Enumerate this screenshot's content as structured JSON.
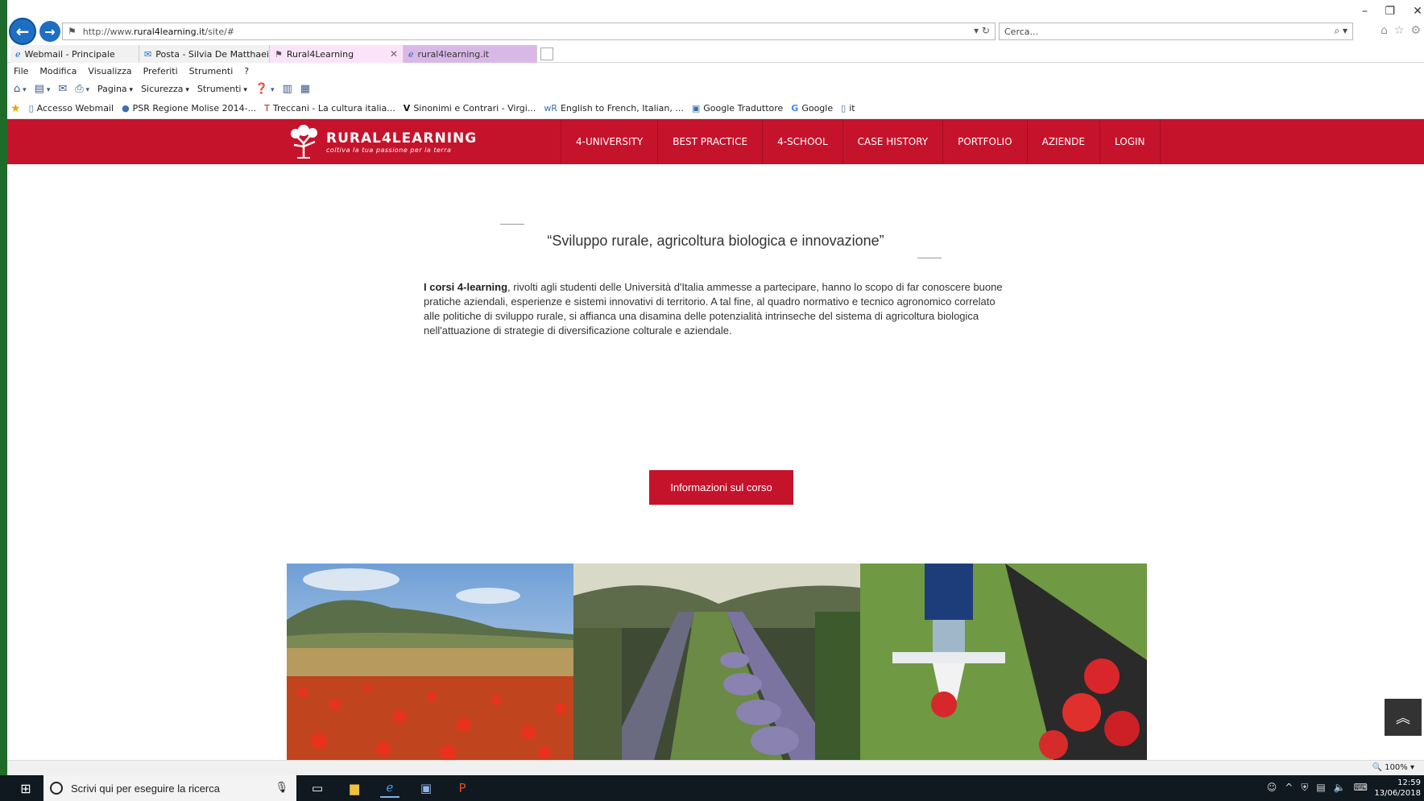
{
  "browser": {
    "address": {
      "prefix": "http://www.",
      "domain": "rural4learning.it",
      "path": "/site/#"
    },
    "search_placeholder": "Cerca...",
    "tabs": [
      {
        "label": "Webmail - Principale",
        "icon": "ie-icon"
      },
      {
        "label": "Posta - Silvia De Matthaeis - O...",
        "icon": "outlook-icon"
      },
      {
        "label": "Rural4Learning",
        "icon": "site-icon",
        "close": "✕"
      },
      {
        "label": "rural4learning.it",
        "icon": "ie-icon"
      }
    ],
    "menu": [
      "File",
      "Modifica",
      "Visualizza",
      "Preferiti",
      "Strumenti",
      "?"
    ],
    "commands": {
      "pagina": "Pagina",
      "sicurezza": "Sicurezza",
      "strumenti": "Strumenti"
    },
    "favorites": [
      {
        "label": "Accesso Webmail",
        "icon": "page-icon"
      },
      {
        "label": "PSR Regione Molise 2014-...",
        "icon": "globe-icon"
      },
      {
        "label": "Treccani - La cultura italia...",
        "icon": "treccani-icon"
      },
      {
        "label": "Sinonimi e Contrari - Virgi...",
        "icon": "virgilio-icon"
      },
      {
        "label": "English to French, Italian, ...",
        "icon": "wordreference-icon"
      },
      {
        "label": "Google Traduttore",
        "icon": "translate-icon"
      },
      {
        "label": "Google",
        "icon": "google-icon"
      },
      {
        "label": "it",
        "icon": "page-icon"
      }
    ],
    "zoom": "100%"
  },
  "site": {
    "brand": "RURAL4LEARNING",
    "tagline": "coltiva la tua passione per la terra",
    "nav": [
      "4-UNIVERSITY",
      "BEST PRACTICE",
      "4-SCHOOL",
      "CASE HISTORY",
      "PORTFOLIO",
      "AZIENDE",
      "LOGIN"
    ],
    "hero_title": "“Sviluppo rurale, agricoltura biologica e innovazione”",
    "intro_bold": "I corsi 4-learning",
    "intro_text": ", rivolti agli studenti delle Università d'Italia ammesse a partecipare, hanno lo scopo di far conoscere buone pratiche aziendali, esperienze e sistemi innovativi di territorio. A tal fine, al quadro normativo e tecnico agronomico correlato alle politiche di sviluppo rurale, si affianca una disamina delle potenzialità intrinseche del sistema di agricoltura biologica nell'attuazione di strategie di diversificazione colturale e aziendale.",
    "cta_label": "Informazioni sul corso",
    "colors": {
      "brand_red": "#c6132c"
    }
  },
  "taskbar": {
    "search_placeholder": "Scrivi qui per eseguire la ricerca",
    "time": "12:59",
    "date": "13/06/2018"
  }
}
